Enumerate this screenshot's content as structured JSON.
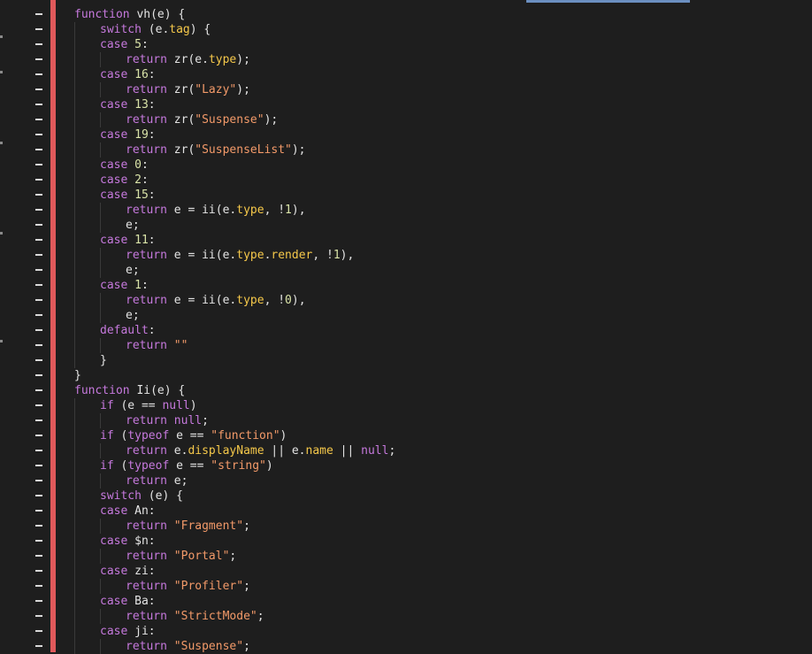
{
  "editor": {
    "colors": {
      "background": "#1e1e1e",
      "keyword": "#c679dd",
      "string": "#f39a69",
      "number": "#d9e3a8",
      "property": "#f5c84a",
      "text": "#e4e4e4",
      "diff_removed_bar": "#e0595b"
    },
    "diff_marker": "-",
    "lines": [
      {
        "indent": 0,
        "tokens": [
          [
            "kw",
            "function"
          ],
          [
            "p",
            " "
          ],
          [
            "fn",
            "vh"
          ],
          [
            "p",
            "(e) {"
          ]
        ]
      },
      {
        "indent": 1,
        "tokens": [
          [
            "kw",
            "switch"
          ],
          [
            "p",
            " (e."
          ],
          [
            "prop",
            "tag"
          ],
          [
            "p",
            ") {"
          ]
        ]
      },
      {
        "indent": 1,
        "tokens": [
          [
            "kw",
            "case"
          ],
          [
            "p",
            " "
          ],
          [
            "num",
            "5"
          ],
          [
            "p",
            ":"
          ]
        ]
      },
      {
        "indent": 2,
        "tokens": [
          [
            "kw",
            "return"
          ],
          [
            "p",
            " zr(e."
          ],
          [
            "prop",
            "type"
          ],
          [
            "p",
            ");"
          ]
        ]
      },
      {
        "indent": 1,
        "tokens": [
          [
            "kw",
            "case"
          ],
          [
            "p",
            " "
          ],
          [
            "num",
            "16"
          ],
          [
            "p",
            ":"
          ]
        ]
      },
      {
        "indent": 2,
        "tokens": [
          [
            "kw",
            "return"
          ],
          [
            "p",
            " zr("
          ],
          [
            "str",
            "\"Lazy\""
          ],
          [
            "p",
            ");"
          ]
        ]
      },
      {
        "indent": 1,
        "tokens": [
          [
            "kw",
            "case"
          ],
          [
            "p",
            " "
          ],
          [
            "num",
            "13"
          ],
          [
            "p",
            ":"
          ]
        ]
      },
      {
        "indent": 2,
        "tokens": [
          [
            "kw",
            "return"
          ],
          [
            "p",
            " zr("
          ],
          [
            "str",
            "\"Suspense\""
          ],
          [
            "p",
            ");"
          ]
        ]
      },
      {
        "indent": 1,
        "tokens": [
          [
            "kw",
            "case"
          ],
          [
            "p",
            " "
          ],
          [
            "num",
            "19"
          ],
          [
            "p",
            ":"
          ]
        ]
      },
      {
        "indent": 2,
        "tokens": [
          [
            "kw",
            "return"
          ],
          [
            "p",
            " zr("
          ],
          [
            "str",
            "\"SuspenseList\""
          ],
          [
            "p",
            ");"
          ]
        ]
      },
      {
        "indent": 1,
        "tokens": [
          [
            "kw",
            "case"
          ],
          [
            "p",
            " "
          ],
          [
            "num",
            "0"
          ],
          [
            "p",
            ":"
          ]
        ]
      },
      {
        "indent": 1,
        "tokens": [
          [
            "kw",
            "case"
          ],
          [
            "p",
            " "
          ],
          [
            "num",
            "2"
          ],
          [
            "p",
            ":"
          ]
        ]
      },
      {
        "indent": 1,
        "tokens": [
          [
            "kw",
            "case"
          ],
          [
            "p",
            " "
          ],
          [
            "num",
            "15"
          ],
          [
            "p",
            ":"
          ]
        ]
      },
      {
        "indent": 2,
        "tokens": [
          [
            "kw",
            "return"
          ],
          [
            "p",
            " e = ii(e."
          ],
          [
            "prop",
            "type"
          ],
          [
            "p",
            ", !"
          ],
          [
            "num",
            "1"
          ],
          [
            "p",
            "),"
          ]
        ]
      },
      {
        "indent": 2,
        "tokens": [
          [
            "p",
            "e;"
          ]
        ]
      },
      {
        "indent": 1,
        "tokens": [
          [
            "kw",
            "case"
          ],
          [
            "p",
            " "
          ],
          [
            "num",
            "11"
          ],
          [
            "p",
            ":"
          ]
        ]
      },
      {
        "indent": 2,
        "tokens": [
          [
            "kw",
            "return"
          ],
          [
            "p",
            " e = ii(e."
          ],
          [
            "prop",
            "type"
          ],
          [
            "p",
            "."
          ],
          [
            "prop",
            "render"
          ],
          [
            "p",
            ", !"
          ],
          [
            "num",
            "1"
          ],
          [
            "p",
            "),"
          ]
        ]
      },
      {
        "indent": 2,
        "tokens": [
          [
            "p",
            "e;"
          ]
        ]
      },
      {
        "indent": 1,
        "tokens": [
          [
            "kw",
            "case"
          ],
          [
            "p",
            " "
          ],
          [
            "num",
            "1"
          ],
          [
            "p",
            ":"
          ]
        ]
      },
      {
        "indent": 2,
        "tokens": [
          [
            "kw",
            "return"
          ],
          [
            "p",
            " e = ii(e."
          ],
          [
            "prop",
            "type"
          ],
          [
            "p",
            ", !"
          ],
          [
            "num",
            "0"
          ],
          [
            "p",
            "),"
          ]
        ]
      },
      {
        "indent": 2,
        "tokens": [
          [
            "p",
            "e;"
          ]
        ]
      },
      {
        "indent": 1,
        "tokens": [
          [
            "kw",
            "default"
          ],
          [
            "p",
            ":"
          ]
        ]
      },
      {
        "indent": 2,
        "tokens": [
          [
            "kw",
            "return"
          ],
          [
            "p",
            " "
          ],
          [
            "str",
            "\"\""
          ]
        ]
      },
      {
        "indent": 1,
        "tokens": [
          [
            "p",
            "}"
          ]
        ]
      },
      {
        "indent": 0,
        "tokens": [
          [
            "p",
            "}"
          ]
        ]
      },
      {
        "indent": 0,
        "tokens": [
          [
            "kw",
            "function"
          ],
          [
            "p",
            " "
          ],
          [
            "fn",
            "Ii"
          ],
          [
            "p",
            "(e) {"
          ]
        ]
      },
      {
        "indent": 1,
        "tokens": [
          [
            "kw",
            "if"
          ],
          [
            "p",
            " (e == "
          ],
          [
            "kw",
            "null"
          ],
          [
            "p",
            ")"
          ]
        ]
      },
      {
        "indent": 2,
        "tokens": [
          [
            "kw",
            "return"
          ],
          [
            "p",
            " "
          ],
          [
            "kw",
            "null"
          ],
          [
            "p",
            ";"
          ]
        ]
      },
      {
        "indent": 1,
        "tokens": [
          [
            "kw",
            "if"
          ],
          [
            "p",
            " ("
          ],
          [
            "kw",
            "typeof"
          ],
          [
            "p",
            " e == "
          ],
          [
            "str",
            "\"function\""
          ],
          [
            "p",
            ")"
          ]
        ]
      },
      {
        "indent": 2,
        "tokens": [
          [
            "kw",
            "return"
          ],
          [
            "p",
            " e."
          ],
          [
            "prop",
            "displayName"
          ],
          [
            "p",
            " || e."
          ],
          [
            "prop",
            "name"
          ],
          [
            "p",
            " || "
          ],
          [
            "kw",
            "null"
          ],
          [
            "p",
            ";"
          ]
        ]
      },
      {
        "indent": 1,
        "tokens": [
          [
            "kw",
            "if"
          ],
          [
            "p",
            " ("
          ],
          [
            "kw",
            "typeof"
          ],
          [
            "p",
            " e == "
          ],
          [
            "str",
            "\"string\""
          ],
          [
            "p",
            ")"
          ]
        ]
      },
      {
        "indent": 2,
        "tokens": [
          [
            "kw",
            "return"
          ],
          [
            "p",
            " e;"
          ]
        ]
      },
      {
        "indent": 1,
        "tokens": [
          [
            "kw",
            "switch"
          ],
          [
            "p",
            " (e) {"
          ]
        ]
      },
      {
        "indent": 1,
        "tokens": [
          [
            "kw",
            "case"
          ],
          [
            "p",
            " An:"
          ]
        ]
      },
      {
        "indent": 2,
        "tokens": [
          [
            "kw",
            "return"
          ],
          [
            "p",
            " "
          ],
          [
            "str",
            "\"Fragment\""
          ],
          [
            "p",
            ";"
          ]
        ]
      },
      {
        "indent": 1,
        "tokens": [
          [
            "kw",
            "case"
          ],
          [
            "p",
            " $n:"
          ]
        ]
      },
      {
        "indent": 2,
        "tokens": [
          [
            "kw",
            "return"
          ],
          [
            "p",
            " "
          ],
          [
            "str",
            "\"Portal\""
          ],
          [
            "p",
            ";"
          ]
        ]
      },
      {
        "indent": 1,
        "tokens": [
          [
            "kw",
            "case"
          ],
          [
            "p",
            " zi:"
          ]
        ]
      },
      {
        "indent": 2,
        "tokens": [
          [
            "kw",
            "return"
          ],
          [
            "p",
            " "
          ],
          [
            "str",
            "\"Profiler\""
          ],
          [
            "p",
            ";"
          ]
        ]
      },
      {
        "indent": 1,
        "tokens": [
          [
            "kw",
            "case"
          ],
          [
            "p",
            " Ba:"
          ]
        ]
      },
      {
        "indent": 2,
        "tokens": [
          [
            "kw",
            "return"
          ],
          [
            "p",
            " "
          ],
          [
            "str",
            "\"StrictMode\""
          ],
          [
            "p",
            ";"
          ]
        ]
      },
      {
        "indent": 1,
        "tokens": [
          [
            "kw",
            "case"
          ],
          [
            "p",
            " ji:"
          ]
        ]
      },
      {
        "indent": 2,
        "tokens": [
          [
            "kw",
            "return"
          ],
          [
            "p",
            " "
          ],
          [
            "str",
            "\"Suspense\""
          ],
          [
            "p",
            ";"
          ]
        ]
      }
    ]
  }
}
